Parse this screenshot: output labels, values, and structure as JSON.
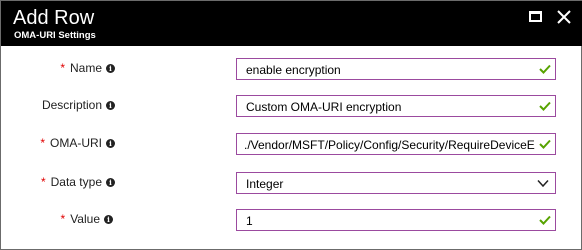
{
  "header": {
    "title": "Add Row",
    "subtitle": "OMA-URI Settings"
  },
  "form": {
    "name": {
      "label": "Name",
      "required": true,
      "value": "enable encryption"
    },
    "description": {
      "label": "Description",
      "required": false,
      "value": "Custom OMA-URI encryption"
    },
    "oma_uri": {
      "label": "OMA-URI",
      "required": true,
      "value": "./Vendor/MSFT/Policy/Config/Security/RequireDeviceE"
    },
    "data_type": {
      "label": "Data type",
      "required": true,
      "value": "Integer"
    },
    "value": {
      "label": "Value",
      "required": true,
      "value": "1"
    }
  },
  "colors": {
    "header_bg": "#000000",
    "field_border": "#9b4a9f",
    "check": "#57a300",
    "required": "#e00000"
  }
}
